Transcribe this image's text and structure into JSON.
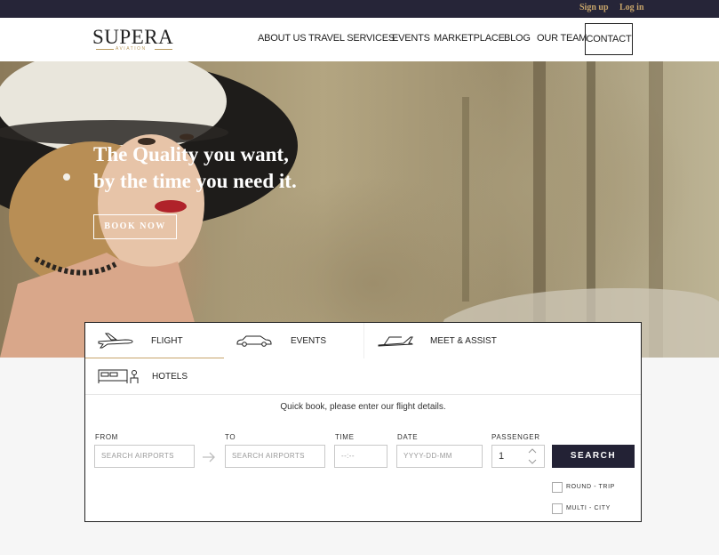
{
  "topbar": {
    "signup": "Sign up",
    "login": "Log in"
  },
  "logo": {
    "name": "SUPERA",
    "tagline": "AVIATION"
  },
  "nav": {
    "about": "ABOUT US",
    "travel": "TRAVEL SERVICES",
    "events": "EVENTS",
    "marketplace": "MARKETPLACE",
    "blog": "BLOG",
    "team": "OUR TEAM",
    "contact": "CONTACT"
  },
  "hero": {
    "line1": "The Quality you want,",
    "line2": "by the time you need it.",
    "cta": "BOOK NOW"
  },
  "tabs": {
    "flight": "FLIGHT",
    "events": "EVENTS",
    "meet": "MEET & ASSIST",
    "hotels": "HOTELS"
  },
  "form": {
    "intro": "Quick book, please enter our flight details.",
    "from_label": "FROM",
    "from_placeholder": "SEARCH AIRPORTS",
    "to_label": "TO",
    "to_placeholder": "SEARCH AIRPORTS",
    "time_label": "TIME",
    "time_placeholder": "--:--",
    "date_label": "DATE",
    "date_placeholder": "YYYY-DD-MM",
    "passenger_label": "PASSENGER",
    "passenger_value": "1",
    "search": "SEARCH",
    "round_trip": "ROUND - TRIP",
    "multi_city": "MULTI - CITY"
  },
  "colors": {
    "dark": "#232235",
    "gold": "#c6a46a"
  },
  "icons": {
    "flight": "airplane-icon",
    "events": "car-icon",
    "meet": "plane-ramp-icon",
    "hotels": "bed-icon",
    "arrow": "arrow-right-icon"
  }
}
